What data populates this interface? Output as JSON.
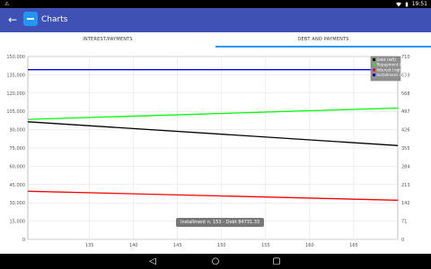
{
  "status": {
    "left_glyph": "⚠",
    "time": "19:51",
    "colors": {
      "bar": "#000000",
      "text": "#ffffff"
    },
    "icons": [
      "wifi-icon",
      "battery-icon"
    ]
  },
  "app": {
    "title": "Charts",
    "back_icon": "arrow-left-icon",
    "app_icon": "app-icon",
    "colors": {
      "appbar": "#3f51b5",
      "accent": "#2196f3"
    }
  },
  "tabs": [
    {
      "label": "INTEREST/PAYMENTS",
      "selected": false
    },
    {
      "label": "DEBT AND PAYMENTS",
      "selected": true
    }
  ],
  "tooltip": {
    "text": "Installment n. 153 - Debt 84731.33"
  },
  "chart_data": {
    "type": "line",
    "x_ticks": [
      "135",
      "140",
      "145",
      "150",
      "155",
      "160",
      "165"
    ],
    "x_tick_values": [
      135,
      140,
      145,
      150,
      155,
      160,
      165
    ],
    "xlim": [
      128,
      170
    ],
    "left_axis": {
      "ticks": [
        "0",
        "15,000",
        "30,000",
        "45,000",
        "60,000",
        "75,000",
        "90,000",
        "105,000",
        "120,000",
        "135,000",
        "150,000"
      ],
      "ylim": [
        0,
        150000
      ]
    },
    "right_axis": {
      "ticks": [
        "0",
        "71",
        "142",
        "213",
        "284",
        "355",
        "426",
        "497",
        "568",
        "639",
        "710"
      ],
      "ylim": [
        0,
        710
      ]
    },
    "series": [
      {
        "name": "Debt (left)",
        "axis": "left",
        "color": "#000000",
        "points": [
          [
            128,
            96500
          ],
          [
            170,
            77000
          ]
        ]
      },
      {
        "name": "Repayment (right)",
        "axis": "right",
        "color": "#00ff00",
        "points": [
          [
            128,
            466
          ],
          [
            170,
            510
          ]
        ]
      },
      {
        "name": "Interest (right)",
        "axis": "right",
        "color": "#ff0000",
        "points": [
          [
            128,
            187
          ],
          [
            170,
            152
          ]
        ]
      },
      {
        "name": "Installment (right)",
        "axis": "right",
        "color": "#0000ff",
        "points": [
          [
            128,
            659
          ],
          [
            170,
            659
          ]
        ]
      }
    ],
    "legend_position": "top-right",
    "grid": true
  }
}
